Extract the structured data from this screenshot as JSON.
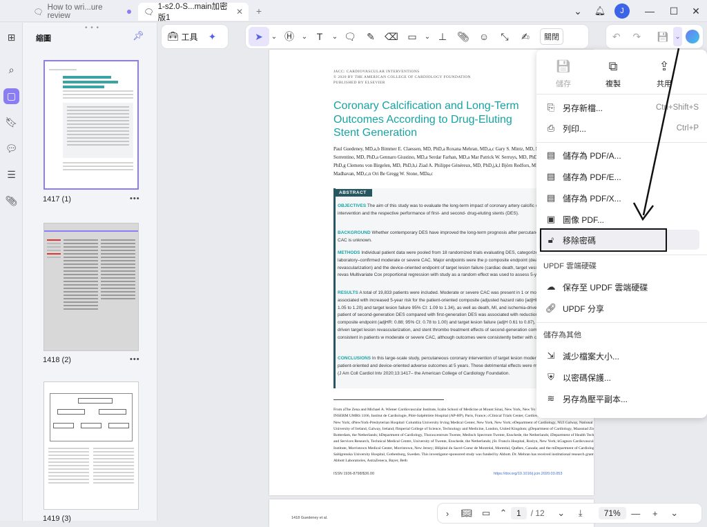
{
  "tabs": [
    {
      "label": "How to wri...ure review",
      "active": false
    },
    {
      "label": "1-s2.0-S...main加密版1",
      "active": true
    }
  ],
  "window": {
    "avatar_letter": "J",
    "add_tab": "+"
  },
  "sidebar": {
    "title": "縮圖",
    "pages": [
      {
        "label": "1417 (1)"
      },
      {
        "label": "1418 (2)"
      },
      {
        "label": "1419 (3)"
      }
    ]
  },
  "toolbar": {
    "tools_label": "工具",
    "close_label": "關閉"
  },
  "document": {
    "journal_line1": "JACC: CARDIOVASCULAR INTERVENTIONS",
    "journal_line2": "© 2020 BY THE AMERICAN COLLEGE OF CARDIOLOGY FOUNDATION",
    "journal_line3": "PUBLISHED BY ELSEVIER",
    "title": "Coronary Calcification and Long-Term Outcomes According to Drug-Eluting Stent Generation",
    "authors": "Paul Guedeney, MD,a,b Bimmer E. Claessen, MD, PhD,a Roxana Mehran, MD,a,c Gary S. Mintz, MD, Mengdan Liu, MS,c Sabato Sorrentino, MD, PhD,a Gennaro Giustino, MD,a Serdar Farhan, MD,a Mar Patrick W. Serruys, MD, PhD,e,f Pieter C. Smits, MD, PhD,g Clemens von Birgelen, MD, PhD,h,i Ziad A. Philippe Généreux, MD, PhD,j,k,l Björn Redfors, MD, PhD,c,m Mahesh V. Madhavan, MD,c,n Ori Be Gregg W. Stone, MDa,c",
    "abstract_label": "ABSTRACT",
    "objectives_label": "OBJECTIVES",
    "objectives": "The aim of this study was to evaluate the long-term impact of coronary artery calcific outcomes after percutaneous coronary intervention and the respective performance of first- and second- drug-eluting stents (DES).",
    "background_label": "BACKGROUND",
    "background": "Whether contemporary DES have improved the long-term prognosis after percutaneo intervention in lesions with severe CAC is unknown.",
    "methods_label": "METHODS",
    "methods": "Individual patient data were pooled from 18 randomized trials evaluating DES, categorized a presence of angiography core laboratory–confirmed moderate or severe CAC. Major endpoints were the p composite endpoint (death, myocardial infarction [MI], or any revascularization) and the device-oriented endpoint of target lesion failure (cardiac death, target vessel MI, or ischemia-driven target lesion revas Multivariate Cox proportional regression with study as a random effect was used to assess 5-year outco",
    "results_label": "RESULTS",
    "results": "A total of 19,833 patients were included. Moderate or severe CAC was present in 1 or more t 6,211 patients (31.3%) and was associated with increased 5-year risk for the patient-oriented composite (adjusted hazard ratio [adjHR]: 1.12; 95% confidence interval [CI]: 1.05 to 1.20) and target lesion failure 95% CI: 1.09 to 1.34), as well as death, MI, and ischemia-driven target lesion revascularization. In patient of second-generation DES compared with first-generation DES was associated with reductions in the 5-y patient-oriented composite endpoint (adjHR: 0.88; 95% CI: 0.78 to 1.00) and target lesion failure (adjH 0.61 to 0.87), as well as death or MI, ischemia-driven target lesion revascularization, and stent thrombo treatment effects of second-generation compared with first-generation DES were consistent in patients w moderate or severe CAC, although outcomes were consistently better with contemporary devices.",
    "conclusions_label": "CONCLUSIONS",
    "conclusions": "In this large-scale study, percutaneous coronary intervention of target lesion moderat was associated with adverse patient-oriented and device-oriented adverse outcomes at 5 years. These detrimental effects were mitigated with second-generation DES. (J Am Coll Cardiol Intv 2020;13:1417– the American College of Cardiology Foundation.",
    "footnote": "From aThe Zena and Michael A. Wiener Cardiovascular Institute, Icahn School of Medicine at Mount Sinai, New York, New Yo bSorbonne Université, ACTION Study Group, INSERM UMRS 1166, Institut de Cardiologie, Pitié-Salpêtrière Hospital (AP-HP), Paris, France; cClinical Trials Center, Cardiovascular Research Foundation, New York, New York; dNewYork-Presbyterian Hospital/ Columbia University Irving Medical Center, New York, New York; eDepartment of Cardiology, NUI Galway, National University of Ireland, Galway, Ireland; fImperial College of Science, Technology and Medicine, London, United Kingdom; gDepartment of Cardiology, Maasstad Ziekenhuis, Rotterdam, the Netherlands; hDepartment of Cardiology, Thoraxcentrum Twente, Medisch Spectrum Twente, Enschede, the Netherlands; iDepartment of Health Technology and Services Research, Technical Medical Centre, University of Twente, Enschede, the Netherlands; jSt. Francis Hospital, Roslyn, New York; kGagnon Cardiovascular Institute, Morristown Medical Center, Morristown, New Jersey; lHôpital du Sacré-Coeur de Montréal, Montréal, Québec, Canada; and the mDepartment of Cardiology, Sahlgrenska University Hospital, Gothenburg, Sweden. This investigator-sponsored study was funded by Abbott. Dr. Mehran has received institutional research grants from Abbott Laboratories, AstraZeneca, Bayer, Beth",
    "issn": "ISSN 1936-8798/$36.00",
    "doi": "https://doi.org/10.1016/j.jcin.2020.03.053",
    "page2_header": "1418     Guedeney et al."
  },
  "menu": {
    "top": [
      {
        "label": "儲存",
        "disabled": true
      },
      {
        "label": "複製",
        "disabled": false
      },
      {
        "label": "共用",
        "disabled": false
      }
    ],
    "items": [
      {
        "label": "另存新檔...",
        "shortcut": "Ctrl+Shift+S"
      },
      {
        "label": "列印...",
        "shortcut": "Ctrl+P"
      },
      {
        "label": "儲存為 PDF/A...",
        "shortcut": ""
      },
      {
        "label": "儲存為 PDF/E...",
        "shortcut": ""
      },
      {
        "label": "儲存為 PDF/X...",
        "shortcut": ""
      },
      {
        "label": "圖像 PDF...",
        "shortcut": ""
      },
      {
        "label": "移除密碼",
        "shortcut": ""
      }
    ],
    "cloud_section": "UPDF 雲端硬碟",
    "cloud_items": [
      {
        "label": "保存至 UPDF 雲端硬碟"
      },
      {
        "label": "UPDF 分享"
      }
    ],
    "other_section": "儲存為其他",
    "other_items": [
      {
        "label": "減少檔案大小..."
      },
      {
        "label": "以密碼保護..."
      },
      {
        "label": "另存為壓平副本..."
      }
    ]
  },
  "bottombar": {
    "page_current": "1",
    "page_total": "/ 12",
    "zoom": "71%"
  }
}
